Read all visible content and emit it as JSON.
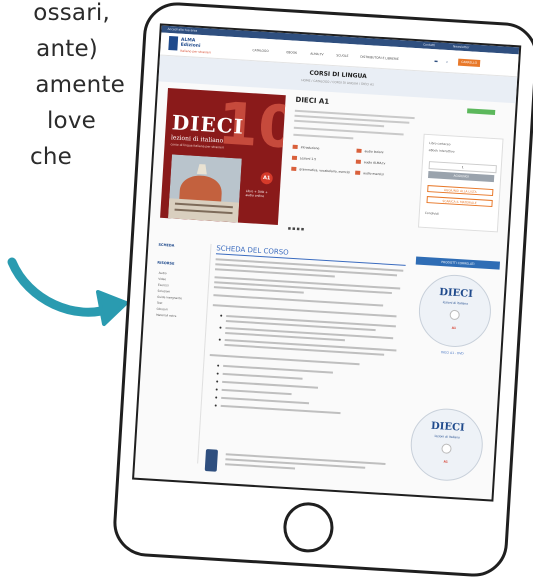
{
  "caption": {
    "lines": [
      "ossari,",
      "ante)",
      "amente",
      "love",
      "che"
    ]
  },
  "site": {
    "brand": "ALMA",
    "brand_sub": "Edizioni",
    "tagline": "Italiano per stranieri",
    "topbar_links": [
      "Accedi alla tua area",
      "Contatti",
      "Newsletter"
    ],
    "menu": [
      "CATALOGO",
      "EBOOK",
      "ALMA.TV",
      "SCUOLE",
      "DISTRIBUTORI E LIBRERIE"
    ],
    "cart_label": "CARRELLO",
    "page_title": "CORSI DI LINGUA",
    "breadcrumb": "HOME / CATALOGO / CORSI DI LINGUA / DIECI A1"
  },
  "product": {
    "title": "DIECI A1",
    "cover": {
      "series": "DIECI",
      "number": "10",
      "subtitle": "lezioni di italiano",
      "course_line": "corso di lingua italiana per stranieri",
      "level": "A1",
      "extra_label": "Libro + DVD + audio online"
    },
    "features": [
      "Introduzione",
      "Lezioni 1-5",
      "grammatica, vocabolario, esercizi",
      "audio lezioni",
      "audio ALMA.tv",
      "audio esercizi"
    ],
    "buy": {
      "option_1": "Libro cartaceo",
      "option_2": "eBook interattivo",
      "quantity": "1",
      "add_button": "AGGIUNGI",
      "link_1": "AGGIUNGI ALLA LISTA",
      "link_2": "SCARICA IL MATERIALE",
      "share": "Condividi"
    }
  },
  "sidebar": {
    "title_1": "SCHEDA",
    "title_2": "RISORSE",
    "items": [
      "Audio",
      "Video",
      "Esercizi",
      "Soluzioni",
      "Guida insegnante",
      "Test",
      "Glossari",
      "Materiali extra"
    ]
  },
  "main": {
    "section_title": "SCHEDA DEL CORSO"
  },
  "related": {
    "header": "PRODOTTI CORRELATI",
    "disc_1_title": "DIECI",
    "disc_1_sub": "lezioni di italiano",
    "disc_1_level": "A1",
    "caption_1": "DIECI A1 - DVD",
    "disc_2_title": "DIECI",
    "disc_2_sub": "lezioni di italiano",
    "disc_2_level": "A1"
  },
  "colors": {
    "accent_teal": "#2a9bb0",
    "brand_blue": "#1f4a8c",
    "cover_red": "#8a1a1a"
  }
}
